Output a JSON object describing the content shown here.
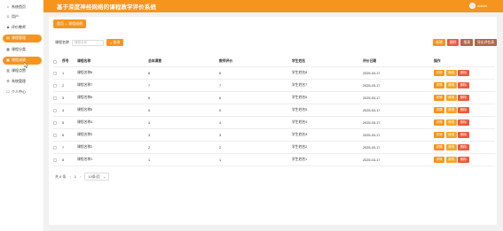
{
  "header": {
    "title": "基于深度神经网络的课程教学评价系统",
    "user": "admin"
  },
  "sidebar": {
    "items": [
      {
        "label": "系统首页",
        "icon": "home-icon",
        "active": false
      },
      {
        "label": "用户",
        "icon": "user-icon",
        "active": false
      },
      {
        "label": "评价教师",
        "icon": "teacher-icon",
        "active": false
      },
      {
        "label": "课程管理",
        "icon": "course-icon",
        "active": true
      },
      {
        "label": "课程分类",
        "icon": "category-icon",
        "active": false
      },
      {
        "label": "课程成绩",
        "icon": "grade-icon",
        "active": true
      },
      {
        "label": "课程点赞",
        "icon": "like-icon",
        "active": false
      },
      {
        "label": "系统管理",
        "icon": "settings-icon",
        "active": false
      },
      {
        "label": "个人中心",
        "icon": "profile-icon",
        "active": false
      }
    ]
  },
  "breadcrumb": {
    "home": "首页",
    "current": "课程成绩"
  },
  "search": {
    "label": "课程名称",
    "placeholder": "课程名称",
    "button": "查询"
  },
  "actions": {
    "add": "新增",
    "delete": "删除",
    "report": "报表",
    "export": "导出评估表"
  },
  "table": {
    "headers": [
      "",
      "序号",
      "课程名称",
      "总体满意",
      "教师评价",
      "学生姓名",
      "评价日期",
      "操作"
    ],
    "rows": [
      {
        "idx": "1",
        "course": "课程名称8",
        "overall": "8",
        "teacher": "8",
        "student": "学生姓名8",
        "date": "2025-03-17"
      },
      {
        "idx": "2",
        "course": "课程名称7",
        "overall": "7",
        "teacher": "7",
        "student": "学生姓名7",
        "date": "2025-03-17"
      },
      {
        "idx": "3",
        "course": "课程名称6",
        "overall": "6",
        "teacher": "6",
        "student": "学生姓名6",
        "date": "2025-03-17"
      },
      {
        "idx": "4",
        "course": "课程名称5",
        "overall": "5",
        "teacher": "5",
        "student": "学生姓名5",
        "date": "2025-03-17"
      },
      {
        "idx": "5",
        "course": "课程名称4",
        "overall": "4",
        "teacher": "4",
        "student": "学生姓名4",
        "date": "2025-03-17"
      },
      {
        "idx": "6",
        "course": "课程名称3",
        "overall": "3",
        "teacher": "3",
        "student": "学生姓名3",
        "date": "2025-03-17"
      },
      {
        "idx": "7",
        "course": "课程名称2",
        "overall": "2",
        "teacher": "2",
        "student": "学生姓名2",
        "date": "2025-03-17"
      },
      {
        "idx": "8",
        "course": "课程名称1",
        "overall": "1",
        "teacher": "1",
        "student": "学生姓名1",
        "date": "2025-03-17"
      }
    ],
    "op_labels": {
      "detail": "详情",
      "edit": "修改",
      "delete": "删除"
    }
  },
  "pager": {
    "total": "共 8 条",
    "page": "1",
    "page_size": "10条/页"
  },
  "colors": {
    "accent": "#f7941d",
    "danger": "#f0573a",
    "dark": "#b5634a",
    "edit": "#f5a623"
  }
}
